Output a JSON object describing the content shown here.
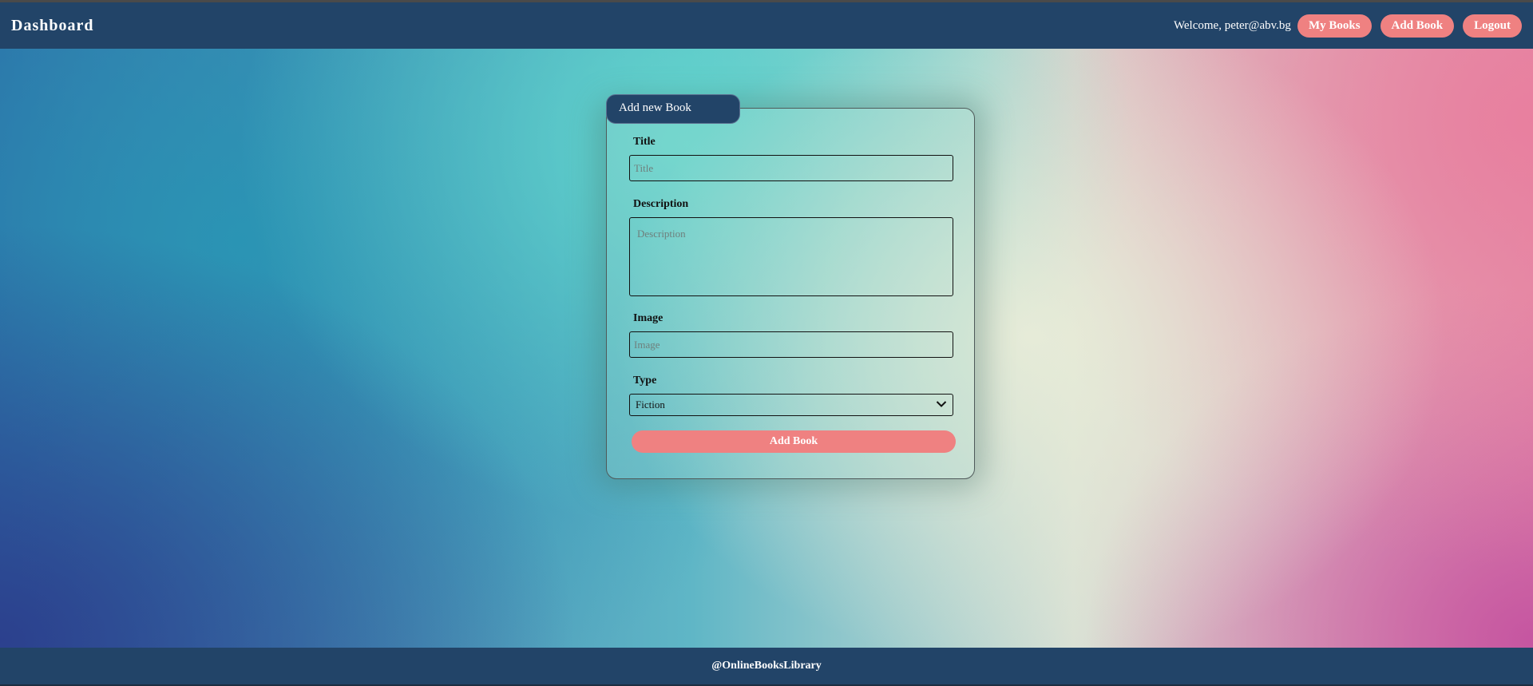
{
  "header": {
    "brand": "Dashboard",
    "welcome": "Welcome, peter@abv.bg",
    "nav": {
      "my_books": "My Books",
      "add_book": "Add Book",
      "logout": "Logout"
    }
  },
  "form": {
    "tab_title": "Add new Book",
    "title_label": "Title",
    "title_placeholder": "Title",
    "description_label": "Description",
    "description_placeholder": "Description",
    "image_label": "Image",
    "image_placeholder": "Image",
    "type_label": "Type",
    "type_selected": "Fiction",
    "submit_label": "Add Book"
  },
  "footer": {
    "text": "@OnlineBooksLibrary"
  },
  "colors": {
    "nav_bg": "#224468",
    "accent": "#ef8181"
  },
  "icons": {
    "type_select": "chevron-down-icon"
  }
}
